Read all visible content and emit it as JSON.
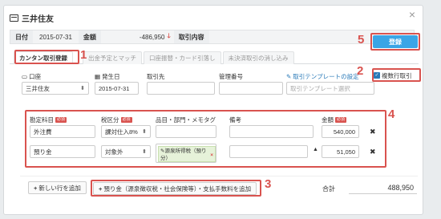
{
  "window": {
    "title": "三井住友",
    "close_label": "×"
  },
  "info": {
    "date_label": "日付",
    "date_value": "2015-07-31",
    "amount_label": "金額",
    "amount_value": "-486,950",
    "content_label": "取引内容"
  },
  "register_button": "登録",
  "tabs": [
    {
      "label": "カンタン取引登録"
    },
    {
      "label": "出金予定とマッチ"
    },
    {
      "label": "口座振替・カード引落し"
    },
    {
      "label": "未決済取引の消し込み"
    }
  ],
  "fields": {
    "account_label": "口座",
    "account_value": "三井住友",
    "occur_date_label": "発生日",
    "occur_date_value": "2015-07-31",
    "partner_label": "取引先",
    "mgmt_label": "管理番号",
    "template_link": "取引テンプレートの設定",
    "template_placeholder": "取引テンプレート選択",
    "multi_line_label": "複数行取引"
  },
  "line_headers": {
    "account": "勘定科目",
    "tax": "税区分",
    "item": "品目・部門・メモタグ",
    "note": "備考",
    "amount": "金額",
    "required": "必須"
  },
  "lines": [
    {
      "account": "外注費",
      "tax": "課対仕入8%",
      "amount": "540,000"
    },
    {
      "account": "預り金",
      "tax": "対象外",
      "tag": "源泉所得税（預り分）",
      "amount": "51,050"
    }
  ],
  "buttons": {
    "add_row": "新しい行を追加",
    "add_deposit": "預り金（源泉徴収税・社会保険等）・支払手数料を追加"
  },
  "total": {
    "label": "合計",
    "value": "488,950"
  },
  "annotations": [
    "1",
    "2",
    "3",
    "4",
    "5"
  ],
  "colors": {
    "accent": "#3aa5e6",
    "highlight": "#d9534f"
  }
}
